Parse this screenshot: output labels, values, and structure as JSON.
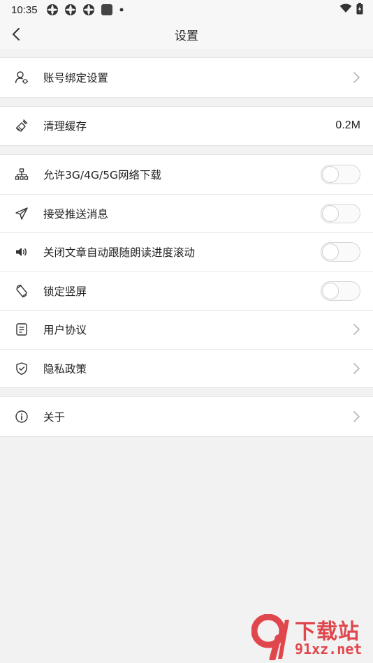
{
  "statusbar": {
    "time": "10:35",
    "notification_icons": [
      "app-icon",
      "app-icon",
      "app-icon",
      "square-icon",
      "dot-icon"
    ],
    "right_icons": [
      "wifi-icon",
      "battery-icon"
    ]
  },
  "header": {
    "title": "设置",
    "back_icon": "chevron-left-icon"
  },
  "groups": [
    {
      "items": [
        {
          "label": "账号绑定设置",
          "icon": "user-settings-icon",
          "control": "chevron"
        }
      ]
    },
    {
      "items": [
        {
          "label": "清理缓存",
          "icon": "broom-icon",
          "control": "value",
          "value": "0.2M"
        }
      ]
    },
    {
      "items": [
        {
          "label": "允许3G/4G/5G网络下载",
          "icon": "network-icon",
          "control": "toggle",
          "on": false
        },
        {
          "label": "接受推送消息",
          "icon": "send-icon",
          "control": "toggle",
          "on": false
        },
        {
          "label": "关闭文章自动跟随朗读进度滚动",
          "icon": "speaker-icon",
          "control": "toggle",
          "on": false
        },
        {
          "label": "锁定竖屏",
          "icon": "rotate-icon",
          "control": "toggle",
          "on": false
        },
        {
          "label": "用户协议",
          "icon": "document-icon",
          "control": "chevron"
        },
        {
          "label": "隐私政策",
          "icon": "shield-icon",
          "control": "chevron"
        }
      ]
    },
    {
      "items": [
        {
          "label": "关于",
          "icon": "info-icon",
          "control": "chevron"
        }
      ]
    }
  ],
  "watermark": {
    "text": "下载站",
    "url": "91xz.net",
    "color": "#e0474d"
  }
}
